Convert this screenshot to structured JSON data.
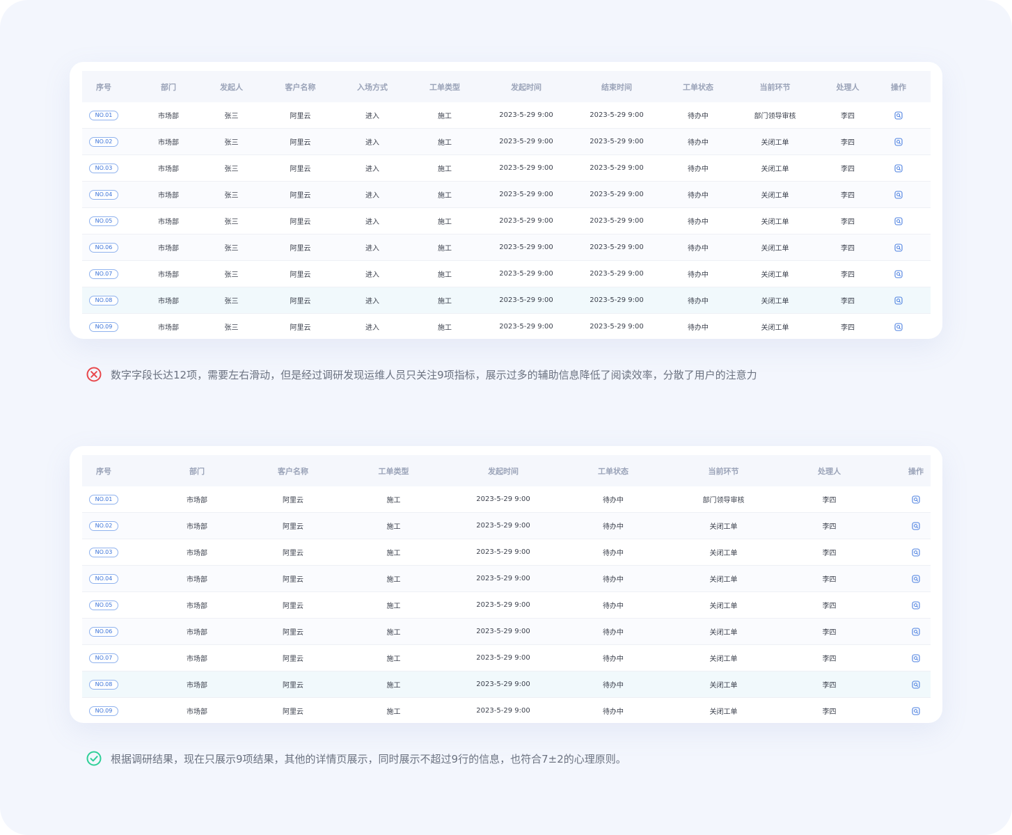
{
  "table1": {
    "columns": [
      "序号",
      "部门",
      "发起人",
      "客户名称",
      "入场方式",
      "工单类型",
      "发起时间",
      "结束时间",
      "工单状态",
      "当前环节",
      "处理人",
      "操作"
    ],
    "rows": [
      {
        "no": "NO.01",
        "dept": "市场部",
        "initiator": "张三",
        "customer": "阿里云",
        "entry": "进入",
        "type": "施工",
        "start": "2023-5-29 9:00",
        "end": "2023-5-29 9:00",
        "status": "待办中",
        "stage": "部门领导审核",
        "handler": "李四"
      },
      {
        "no": "NO.02",
        "dept": "市场部",
        "initiator": "张三",
        "customer": "阿里云",
        "entry": "进入",
        "type": "施工",
        "start": "2023-5-29 9:00",
        "end": "2023-5-29 9:00",
        "status": "待办中",
        "stage": "关闭工单",
        "handler": "李四"
      },
      {
        "no": "NO.03",
        "dept": "市场部",
        "initiator": "张三",
        "customer": "阿里云",
        "entry": "进入",
        "type": "施工",
        "start": "2023-5-29 9:00",
        "end": "2023-5-29 9:00",
        "status": "待办中",
        "stage": "关闭工单",
        "handler": "李四"
      },
      {
        "no": "NO.04",
        "dept": "市场部",
        "initiator": "张三",
        "customer": "阿里云",
        "entry": "进入",
        "type": "施工",
        "start": "2023-5-29 9:00",
        "end": "2023-5-29 9:00",
        "status": "待办中",
        "stage": "关闭工单",
        "handler": "李四"
      },
      {
        "no": "NO.05",
        "dept": "市场部",
        "initiator": "张三",
        "customer": "阿里云",
        "entry": "进入",
        "type": "施工",
        "start": "2023-5-29 9:00",
        "end": "2023-5-29 9:00",
        "status": "待办中",
        "stage": "关闭工单",
        "handler": "李四"
      },
      {
        "no": "NO.06",
        "dept": "市场部",
        "initiator": "张三",
        "customer": "阿里云",
        "entry": "进入",
        "type": "施工",
        "start": "2023-5-29 9:00",
        "end": "2023-5-29 9:00",
        "status": "待办中",
        "stage": "关闭工单",
        "handler": "李四"
      },
      {
        "no": "NO.07",
        "dept": "市场部",
        "initiator": "张三",
        "customer": "阿里云",
        "entry": "进入",
        "type": "施工",
        "start": "2023-5-29 9:00",
        "end": "2023-5-29 9:00",
        "status": "待办中",
        "stage": "关闭工单",
        "handler": "李四"
      },
      {
        "no": "NO.08",
        "dept": "市场部",
        "initiator": "张三",
        "customer": "阿里云",
        "entry": "进入",
        "type": "施工",
        "start": "2023-5-29 9:00",
        "end": "2023-5-29 9:00",
        "status": "待办中",
        "stage": "关闭工单",
        "handler": "李四"
      },
      {
        "no": "NO.09",
        "dept": "市场部",
        "initiator": "张三",
        "customer": "阿里云",
        "entry": "进入",
        "type": "施工",
        "start": "2023-5-29 9:00",
        "end": "2023-5-29 9:00",
        "status": "待办中",
        "stage": "关闭工单",
        "handler": "李四"
      }
    ]
  },
  "note1": {
    "icon": "error-circle-icon",
    "text": "数字字段长达12项，需要左右滑动，但是经过调研发现运维人员只关注9项指标，展示过多的辅助信息降低了阅读效率，分散了用户的注意力"
  },
  "table2": {
    "columns": [
      "序号",
      "部门",
      "客户名称",
      "工单类型",
      "发起时间",
      "工单状态",
      "当前环节",
      "处理人",
      "操作"
    ],
    "rows": [
      {
        "no": "NO.01",
        "dept": "市场部",
        "customer": "阿里云",
        "type": "施工",
        "start": "2023-5-29 9:00",
        "status": "待办中",
        "stage": "部门领导审核",
        "handler": "李四"
      },
      {
        "no": "NO.02",
        "dept": "市场部",
        "customer": "阿里云",
        "type": "施工",
        "start": "2023-5-29 9:00",
        "status": "待办中",
        "stage": "关闭工单",
        "handler": "李四"
      },
      {
        "no": "NO.03",
        "dept": "市场部",
        "customer": "阿里云",
        "type": "施工",
        "start": "2023-5-29 9:00",
        "status": "待办中",
        "stage": "关闭工单",
        "handler": "李四"
      },
      {
        "no": "NO.04",
        "dept": "市场部",
        "customer": "阿里云",
        "type": "施工",
        "start": "2023-5-29 9:00",
        "status": "待办中",
        "stage": "关闭工单",
        "handler": "李四"
      },
      {
        "no": "NO.05",
        "dept": "市场部",
        "customer": "阿里云",
        "type": "施工",
        "start": "2023-5-29 9:00",
        "status": "待办中",
        "stage": "关闭工单",
        "handler": "李四"
      },
      {
        "no": "NO.06",
        "dept": "市场部",
        "customer": "阿里云",
        "type": "施工",
        "start": "2023-5-29 9:00",
        "status": "待办中",
        "stage": "关闭工单",
        "handler": "李四"
      },
      {
        "no": "NO.07",
        "dept": "市场部",
        "customer": "阿里云",
        "type": "施工",
        "start": "2023-5-29 9:00",
        "status": "待办中",
        "stage": "关闭工单",
        "handler": "李四"
      },
      {
        "no": "NO.08",
        "dept": "市场部",
        "customer": "阿里云",
        "type": "施工",
        "start": "2023-5-29 9:00",
        "status": "待办中",
        "stage": "关闭工单",
        "handler": "李四"
      },
      {
        "no": "NO.09",
        "dept": "市场部",
        "customer": "阿里云",
        "type": "施工",
        "start": "2023-5-29 9:00",
        "status": "待办中",
        "stage": "关闭工单",
        "handler": "李四"
      }
    ]
  },
  "note2": {
    "icon": "check-circle-icon",
    "text": "根据调研结果，现在只展示9项结果，其他的详情页展示，同时展示不超过9行的信息，也符合7±2的心理原则。"
  },
  "colors": {
    "page_bg": "#f3f6fd",
    "card_bg": "#ffffff",
    "header_bg": "#f5f7fc",
    "header_text": "#9aa3b8",
    "tag_blue": "#3a72d8",
    "highlight_row": "#f1f9fc",
    "error_red": "#e8474b",
    "success_green": "#2ecf97"
  }
}
